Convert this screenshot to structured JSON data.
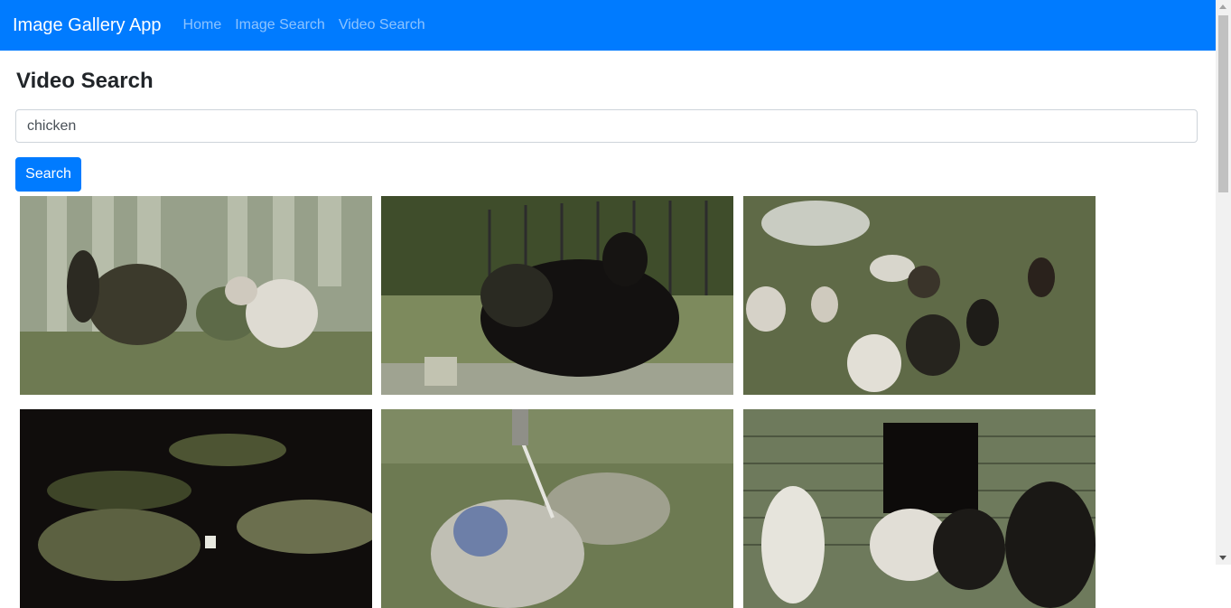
{
  "navbar": {
    "brand": "Image Gallery App",
    "links": [
      {
        "label": "Home"
      },
      {
        "label": "Image Search"
      },
      {
        "label": "Video Search"
      }
    ]
  },
  "main": {
    "title": "Video Search",
    "search": {
      "value": "chicken"
    },
    "search_button_label": "Search"
  },
  "results": [
    {
      "icon": "rooster-and-hens-by-wooden-fence-thumbnail"
    },
    {
      "icon": "dark-hen-on-patio-thumbnail"
    },
    {
      "icon": "goat-and-chickens-on-grass-thumbnail"
    },
    {
      "icon": "chicken-pieces-grilling-thumbnail"
    },
    {
      "icon": "hand-cutting-raw-chicken-thumbnail"
    },
    {
      "icon": "chickens-by-brick-coop-thumbnail"
    }
  ],
  "colors": {
    "primary": "#007bff"
  }
}
